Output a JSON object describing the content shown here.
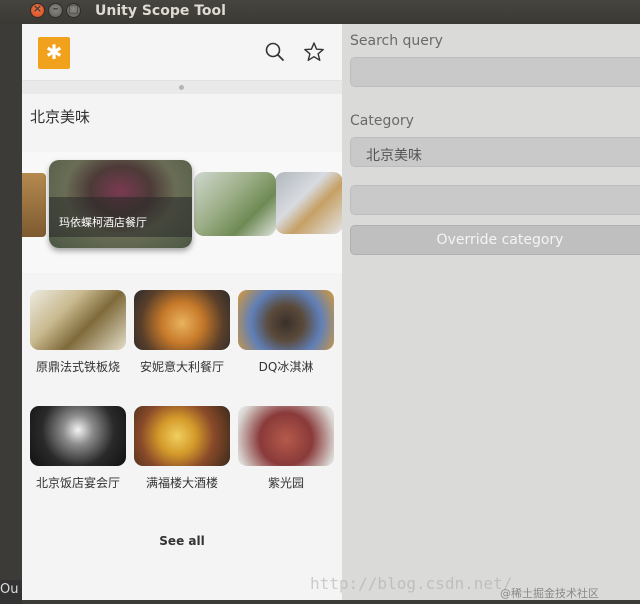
{
  "window": {
    "title": "Unity Scope Tool"
  },
  "scope": {
    "category_title": "北京美味",
    "carousel_featured_name": "玛依蝶柯酒店餐厅",
    "grid": [
      {
        "name": "原鼎法式铁板烧",
        "thumb": "linear-gradient(135deg,#eceae0 0%,#c9b98f 35%,#7f6a3a 60%,#e3ddc8 100%)"
      },
      {
        "name": "安妮意大利餐厅",
        "thumb": "radial-gradient(circle at 50% 55%,#e8b35f 0%,#c77a2a 35%,#5a3f2a 70%,#2d2a2a 100%)"
      },
      {
        "name": "DQ冰淇淋",
        "thumb": "radial-gradient(circle at 50% 55%,#3a302a 0%,#5a4a3a 30%,#5f7fb8 60%,#d69a3a 100%)"
      },
      {
        "name": "北京饭店宴会厅",
        "thumb": "radial-gradient(circle at 50% 40%,#f4f4f4 0%,#8a8a8a 25%,#2a2a2a 60%,#111 100%)"
      },
      {
        "name": "满福楼大酒楼",
        "thumb": "radial-gradient(circle at 45% 50%,#f0d060 0%,#d49a2a 30%,#8a4a2a 60%,#3a2a1a 100%)"
      },
      {
        "name": "紫光园",
        "thumb": "radial-gradient(circle at 50% 55%,#b45a4a 0%,#8a3a3a 45%,#d8d4d0 85%,#eee 100%)"
      }
    ],
    "see_all_label": "See all"
  },
  "panel": {
    "search_label": "Search query",
    "search_value": "",
    "category_label": "Category",
    "category_value": "北京美味",
    "extra_value": "",
    "override_label": "Override category"
  },
  "watermark": "http://blog.csdn.net/",
  "watermark_credit": "@稀土掘金技术社区",
  "taskbar_text": "Ou",
  "colors": {
    "accent": "#f2a11c",
    "titlebar": "#3c3b37",
    "panel": "#dadad9"
  }
}
